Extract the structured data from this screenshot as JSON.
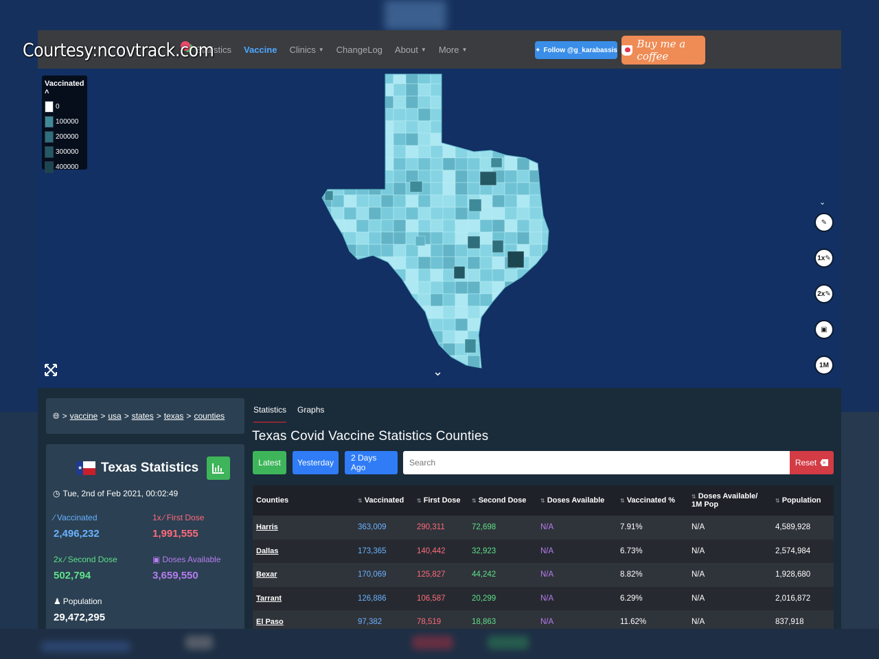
{
  "watermark": "Courtesy:ncovtrack.com",
  "nav": {
    "items": [
      {
        "label": "Statistics",
        "dropdown": false,
        "active": false
      },
      {
        "label": "Vaccine",
        "dropdown": false,
        "active": true
      },
      {
        "label": "Clinics",
        "dropdown": true,
        "active": false
      },
      {
        "label": "ChangeLog",
        "dropdown": false,
        "active": false
      },
      {
        "label": "About",
        "dropdown": true,
        "active": false
      },
      {
        "label": "More",
        "dropdown": true,
        "active": false
      }
    ],
    "twitter_label": "Follow @g_karabassis",
    "coffee_label": "Buy me a coffee"
  },
  "legend": {
    "title": "Vaccinated",
    "items": [
      {
        "label": "0",
        "color": "#ffffff"
      },
      {
        "label": "100000",
        "color": "#3f8a99"
      },
      {
        "label": "200000",
        "color": "#2f6e7c"
      },
      {
        "label": "300000",
        "color": "#245964"
      },
      {
        "label": "400000",
        "color": "#1b4650"
      }
    ]
  },
  "map_controls": [
    "pen-icon",
    "1x-pen-icon",
    "2x-pen-icon",
    "boxes-icon",
    "1M"
  ],
  "breadcrumb": [
    "vaccine",
    "usa",
    "states",
    "texas",
    "counties"
  ],
  "stats": {
    "title": "Texas Statistics",
    "date": "Tue, 2nd of Feb 2021, 00:02:49",
    "vaccinated_label": "Vaccinated",
    "vaccinated_value": "2,496,232",
    "first_label": "First Dose",
    "first_prefix": "1x",
    "first_value": "1,991,555",
    "second_label": "Second Dose",
    "second_prefix": "2x",
    "second_value": "502,794",
    "doses_label": "Doses Available",
    "doses_value": "3,659,550",
    "population_label": "Population",
    "population_value": "29,472,295"
  },
  "tabs": [
    "Statistics",
    "Graphs"
  ],
  "panel_title": "Texas Covid Vaccine Statistics Counties",
  "buttons": {
    "latest": "Latest",
    "yesterday": "Yesterday",
    "two_days": "2 Days Ago",
    "reset": "Reset"
  },
  "search_placeholder": "Search",
  "table": {
    "headers": [
      "Counties",
      "Vaccinated",
      "First Dose",
      "Second Dose",
      "Doses Available",
      "Vaccinated %",
      "Doses Available/ 1M Pop",
      "Population"
    ],
    "rows": [
      [
        "Harris",
        "363,009",
        "290,311",
        "72,698",
        "N/A",
        "7.91%",
        "N/A",
        "4,589,928"
      ],
      [
        "Dallas",
        "173,365",
        "140,442",
        "32,923",
        "N/A",
        "6.73%",
        "N/A",
        "2,574,984"
      ],
      [
        "Bexar",
        "170,069",
        "125,827",
        "44,242",
        "N/A",
        "8.82%",
        "N/A",
        "1,928,680"
      ],
      [
        "Tarrant",
        "126,886",
        "106,587",
        "20,299",
        "N/A",
        "6.29%",
        "N/A",
        "2,016,872"
      ],
      [
        "El Paso",
        "97,382",
        "78,519",
        "18,863",
        "N/A",
        "11.62%",
        "N/A",
        "837,918"
      ]
    ]
  },
  "colors": {
    "navbar": "#3a3c40",
    "map_background": "#123063",
    "vaccinated": "#6ab2ff",
    "first_dose": "#ff6b7a",
    "second_dose": "#5fe08a",
    "doses_available": "#b67df0",
    "latest_button": "#3eb55a",
    "day_buttons": "#2f7cf6",
    "reset_button": "#d33b45"
  }
}
